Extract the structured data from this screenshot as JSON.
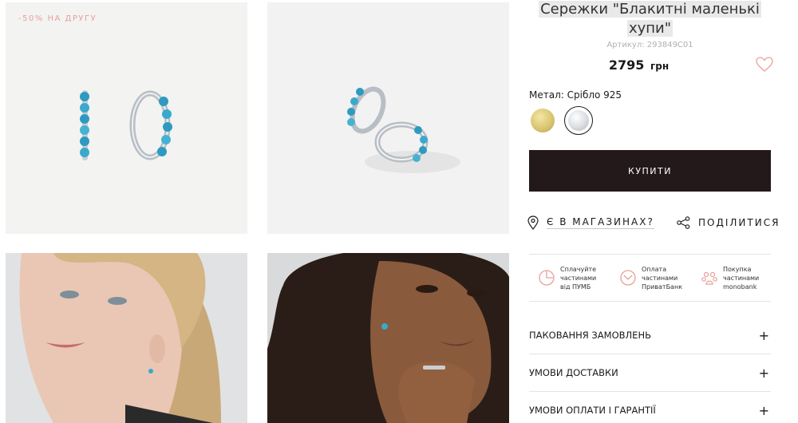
{
  "gallery": {
    "promo_badge": "-50% НА ДРУГУ"
  },
  "product": {
    "title_line1": "Сережки \"Блакитні маленькі",
    "title_line2": "хупи\"",
    "sku": "Артикул: 293849C01",
    "price": "2795",
    "currency": "грн",
    "metal_label": "Метал: Срібло 925",
    "metal_options": [
      "gold",
      "silver"
    ],
    "metal_selected": "silver",
    "buy_label": "КУПИТИ"
  },
  "actions": {
    "stores_label": "Є В МАГАЗИНАХ?",
    "share_label": "ПОДІЛИТИСЯ"
  },
  "payments": [
    {
      "text": "Сплачуйте\nчастинами\nвід ПУМБ",
      "icon": "pumb-icon"
    },
    {
      "text": "Оплата\nчастинами\nПриватБанк",
      "icon": "privatbank-icon"
    },
    {
      "text": "Покупка\nчастинами\nmonobank",
      "icon": "monobank-icon"
    }
  ],
  "accordion": [
    {
      "label": "ПАКОВАННЯ ЗАМОВЛЕНЬ"
    },
    {
      "label": "УМОВИ ДОСТАВКИ"
    },
    {
      "label": "УМОВИ ОПЛАТИ І ГАРАНТІЇ"
    }
  ],
  "colors": {
    "accent": "#e8a09a",
    "buy_button": "#23191a",
    "gem": "#3ea6c8"
  }
}
